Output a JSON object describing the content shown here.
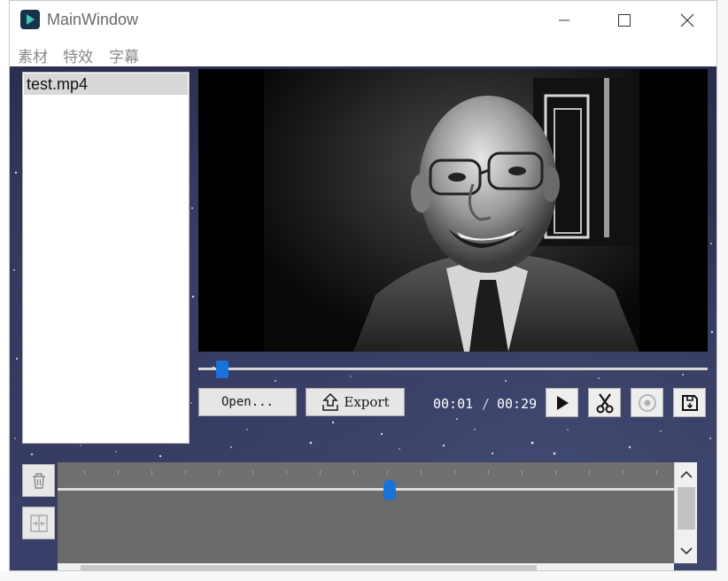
{
  "window": {
    "title": "MainWindow",
    "minimize_icon": "minimize-icon",
    "maximize_icon": "maximize-icon",
    "close_icon": "close-icon"
  },
  "menu": {
    "items": [
      "素材",
      "特效",
      "字幕"
    ]
  },
  "file_list": {
    "items": [
      "test.mp4"
    ]
  },
  "player": {
    "seek_fraction": 0.035,
    "open_label": "Open...",
    "export_label": "Export",
    "current_time": "00:01",
    "time_separator": "/",
    "total_time": "00:29"
  },
  "controls": {
    "play_icon": "play-icon",
    "cut_icon": "scissors-icon",
    "record_icon": "record-icon",
    "save_icon": "save-icon"
  },
  "timeline": {
    "delete_icon": "trash-icon",
    "split_icon": "split-icon",
    "playhead_fraction": 0.54
  },
  "colors": {
    "accent": "#1a73d8",
    "background": "#2f3356"
  }
}
